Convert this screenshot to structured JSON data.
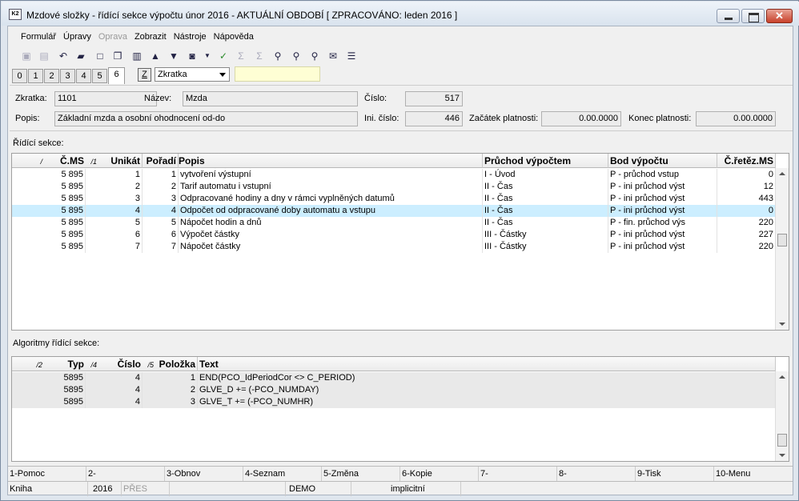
{
  "window": {
    "title": "Mzdové složky - řídící sekce výpočtu      únor 2016 - AKTUÁLNÍ OBDOBÍ [ ZPRACOVÁNO: leden 2016 ]",
    "icon_text": "K2",
    "close_symbol": "✕"
  },
  "menu": [
    "Formulář",
    "Úpravy",
    "Oprava",
    "Zobrazit",
    "Nástroje",
    "Nápověda"
  ],
  "tabs": [
    "0",
    "1",
    "2",
    "3",
    "4",
    "5",
    "6"
  ],
  "active_tab": "6",
  "filter": {
    "z_button": "Z",
    "select_value": "Zkratka"
  },
  "header": {
    "zkratka_label": "Zkratka:",
    "zkratka_value": "1101",
    "nazev_label": "Název:",
    "nazev_value": "Mzda",
    "cislo_label": "Číslo:",
    "cislo_value": "517",
    "popis_label": "Popis:",
    "popis_value": "Základní mzda a osobní ohodnocení od-do",
    "ini_cislo_label": "Ini. číslo:",
    "ini_cislo_value": "446",
    "zacatek_label": "Začátek platnosti:",
    "zacatek_value": "0.00.0000",
    "konec_label": "Konec platnosti:",
    "konec_value": "0.00.0000"
  },
  "ridici": {
    "section_label": "Řídící sekce:",
    "columns": [
      "/",
      "Č.MS",
      "/1",
      "Unikát",
      "Pořadí",
      "Popis",
      "Průchod výpočtem",
      "Bod výpočtu",
      "Č.řetěz.MS"
    ],
    "rows": [
      {
        "cms": "5 895",
        "unikat": "1",
        "poradi": "1",
        "popis": "vytvoření výstupní",
        "pruchod": "I - Úvod",
        "bod": "P - průchod vstup",
        "retez": "0"
      },
      {
        "cms": "5 895",
        "unikat": "2",
        "poradi": "2",
        "popis": "Tarif automatu i vstupní",
        "pruchod": "II - Čas",
        "bod": "P - ini průchod výst",
        "retez": "12"
      },
      {
        "cms": "5 895",
        "unikat": "3",
        "poradi": "3",
        "popis": "Odpracované hodiny a dny v rámci vyplněných datumů",
        "pruchod": "II - Čas",
        "bod": "P - ini průchod výst",
        "retez": "443"
      },
      {
        "cms": "5 895",
        "unikat": "4",
        "poradi": "4",
        "popis": "Odpočet od odpracované doby automatu a vstupu",
        "pruchod": "II - Čas",
        "bod": "P - ini průchod výst",
        "retez": "0"
      },
      {
        "cms": "5 895",
        "unikat": "5",
        "poradi": "5",
        "popis": "Nápočet hodin a dnů",
        "pruchod": "II - Čas",
        "bod": "P - fin. průchod výs",
        "retez": "220"
      },
      {
        "cms": "5 895",
        "unikat": "6",
        "poradi": "6",
        "popis": "Výpočet částky",
        "pruchod": "III - Částky",
        "bod": "P - ini průchod výst",
        "retez": "227"
      },
      {
        "cms": "5 895",
        "unikat": "7",
        "poradi": "7",
        "popis": "Nápočet částky",
        "pruchod": "III - Částky",
        "bod": "P - ini průchod výst",
        "retez": "220"
      }
    ],
    "selected_row": 3
  },
  "algoritmy": {
    "section_label": "Algoritmy řídící sekce:",
    "columns": [
      "/2",
      "Typ",
      "/4",
      "Číslo",
      "/5",
      "Položka",
      "Text"
    ],
    "rows": [
      {
        "typ": "5895",
        "cislo": "4",
        "polozka": "1",
        "text": "END(PCO_IdPeriodCor <> C_PERIOD)"
      },
      {
        "typ": "5895",
        "cislo": "4",
        "polozka": "2",
        "text": "GLVE_D += (-PCO_NUMDAY)"
      },
      {
        "typ": "5895",
        "cislo": "4",
        "polozka": "3",
        "text": "GLVE_T += (-PCO_NUMHR)"
      }
    ]
  },
  "fkeys": [
    "1-Pomoc",
    "2-",
    "3-Obnov",
    "4-Seznam",
    "5-Změna",
    "6-Kopie",
    "7-",
    "8-",
    "9-Tisk",
    "10-Menu"
  ],
  "status": {
    "s1": "Kniha",
    "s2": "2016",
    "s3": "PŘES",
    "s4": "DEMO",
    "s5": "implicitní"
  },
  "colors": {
    "selected_row": "#cceeff",
    "filter_box": "#fefed4",
    "close_button": "#c8412a"
  }
}
